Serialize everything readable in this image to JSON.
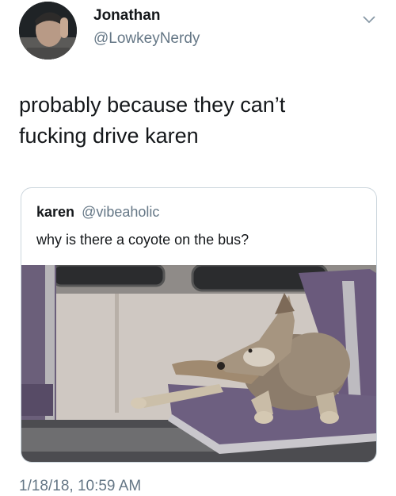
{
  "tweet": {
    "author_name": "Jonathan",
    "author_handle": "@LowkeyNerdy",
    "text_lines": [
      "probably because they can’t",
      "fucking drive karen"
    ],
    "timestamp": "1/18/18, 10:59 AM"
  },
  "quoted_tweet": {
    "author_name": "karen",
    "author_handle": "@vibeaholic",
    "text": "why is there a coyote on the bus?"
  },
  "icons": {
    "menu": "chevron-down-icon"
  }
}
